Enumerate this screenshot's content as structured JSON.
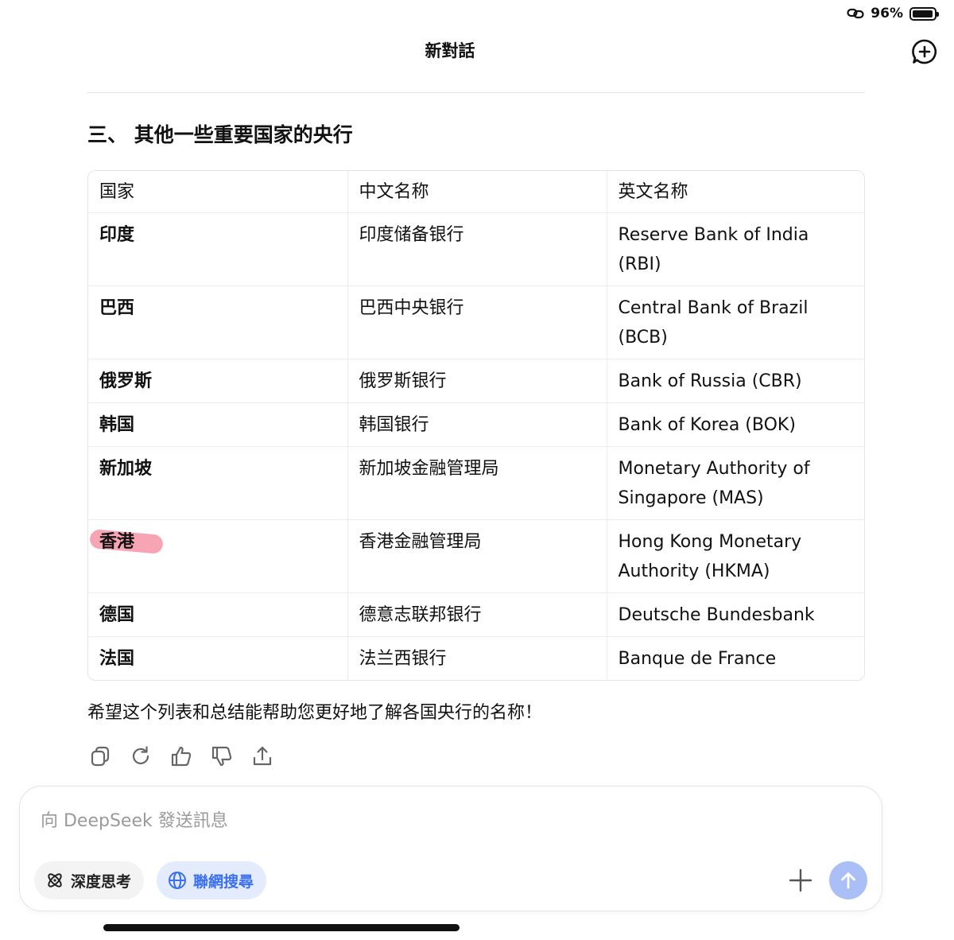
{
  "status_bar": {
    "battery_text": "96%",
    "battery_level": 0.96
  },
  "header": {
    "title": "新對話"
  },
  "content": {
    "section_heading": "三、 其他一些重要国家的央行",
    "table": {
      "headers": [
        "国家",
        "中文名称",
        "英文名称"
      ],
      "rows": [
        {
          "country": "印度",
          "cn_name": "印度储备银行",
          "en_name": "Reserve Bank of India (RBI)"
        },
        {
          "country": "巴西",
          "cn_name": "巴西中央银行",
          "en_name": "Central Bank of Brazil (BCB)"
        },
        {
          "country": "俄罗斯",
          "cn_name": "俄罗斯银行",
          "en_name": "Bank of Russia (CBR)"
        },
        {
          "country": "韩国",
          "cn_name": "韩国银行",
          "en_name": "Bank of Korea (BOK)"
        },
        {
          "country": "新加坡",
          "cn_name": "新加坡金融管理局",
          "en_name": "Monetary Authority of Singapore (MAS)"
        },
        {
          "country": "香港",
          "cn_name": "香港金融管理局",
          "en_name": "Hong Kong Monetary Authority (HKMA)"
        },
        {
          "country": "德国",
          "cn_name": "德意志联邦银行",
          "en_name": "Deutsche Bundesbank"
        },
        {
          "country": "法国",
          "cn_name": "法兰西银行",
          "en_name": "Banque de France"
        }
      ]
    },
    "closing_text": "希望这个列表和总结能帮助您更好地了解各国央行的名称！"
  },
  "message_actions": [
    "copy-icon",
    "regenerate-icon",
    "thumbs-up-icon",
    "thumbs-down-icon",
    "share-icon"
  ],
  "composer": {
    "placeholder": "向 DeepSeek 發送訊息",
    "deep_think_label": "深度思考",
    "web_search_label": "聯網搜尋"
  },
  "colors": {
    "accent_blue": "#3a6ff0",
    "web_chip_bg": "#e3ebfd",
    "send_button": "#a9bff6",
    "highlight": "#f05a78"
  }
}
